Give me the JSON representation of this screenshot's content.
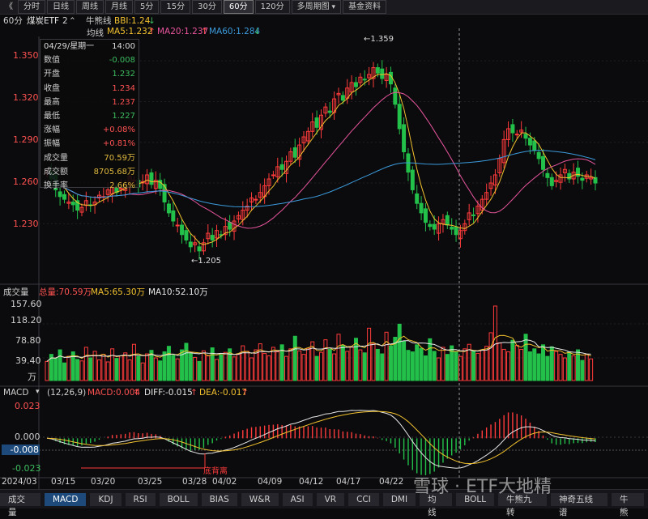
{
  "toolbar": {
    "back_label": "《",
    "items": [
      "分时",
      "日线",
      "周线",
      "月线",
      "5分",
      "15分",
      "30分",
      "60分",
      "120分"
    ],
    "active": "60分",
    "multi_period": "多周期图",
    "fund_info": "基金资料"
  },
  "header": {
    "period": "60分",
    "name": "煤炭ETF",
    "count": "2",
    "bull_label": "牛熊线",
    "bbi": "BBI:1.24",
    "avg_label": "均线",
    "ma5": "MA5:1.232",
    "ma20": "MA20:1.237",
    "ma60": "MA60:1.284",
    "ma5_arrow": "↑",
    "ma20_arrow": "↑",
    "ma60_arrow": "↓",
    "bbi_arrow": "↓"
  },
  "info": {
    "date": "04/29/星期一",
    "time": "14:00",
    "rows": [
      {
        "label": "数值",
        "value": "-0.008",
        "color": "#3dbd5f"
      },
      {
        "label": "开盘",
        "value": "1.232",
        "color": "#3dbd5f"
      },
      {
        "label": "收盘",
        "value": "1.234",
        "color": "#ff5252"
      },
      {
        "label": "最高",
        "value": "1.237",
        "color": "#ff5252"
      },
      {
        "label": "最低",
        "value": "1.227",
        "color": "#3dbd5f"
      },
      {
        "label": "涨幅",
        "value": "+0.08%",
        "color": "#ff5252"
      },
      {
        "label": "振幅",
        "value": "+0.81%",
        "color": "#ff5252"
      },
      {
        "label": "成交量",
        "value": "70.59万",
        "color": "#e0b93c"
      },
      {
        "label": "成交额",
        "value": "8705.68万",
        "color": "#e0b93c"
      },
      {
        "label": "换手率",
        "value": "2.66%",
        "color": "#e0b93c"
      }
    ]
  },
  "price_axis": [
    "1.350",
    "1.320",
    "1.290",
    "1.260",
    "1.230"
  ],
  "annotations": {
    "high": "←1.359",
    "low": "←1.205",
    "divergence": "底背离"
  },
  "volume": {
    "title": "成交量",
    "total": "总量:70.59万",
    "ma5": "MA5:65.30万",
    "ma10": "MA10:52.10万",
    "axis": [
      "157.60",
      "118.20",
      "78.80",
      "39.40",
      "万"
    ]
  },
  "macd": {
    "title": "MACD",
    "params": "(12,26,9)",
    "macd": "MACD:0.004",
    "diff": "DIFF:-0.015",
    "dea": "DEA:-0.017",
    "macd_arrow": "↑",
    "diff_arrow": "↑",
    "dea_arrow": "↑",
    "axis": [
      "0.023",
      "0.000",
      "-0.008",
      "-0.023"
    ]
  },
  "dates": [
    "2024/03",
    "03/15",
    "03/20",
    "03/25",
    "03/28",
    "04/02",
    "04/09",
    "04/12",
    "04/17",
    "04/22"
  ],
  "tabs": [
    "成交量",
    "MACD",
    "KDJ",
    "RSI",
    "BOLL",
    "BIAS",
    "W&R",
    "ASI",
    "VR",
    "CCI",
    "DMI",
    "均线",
    "BOLL",
    "牛熊九转",
    "神奇五线谱",
    "牛熊"
  ],
  "active_tab": "MACD",
  "watermark": "雪球 · ETF大地精",
  "chart_data": {
    "type": "candlestick",
    "title": "煤炭ETF 60分",
    "ylim": [
      1.195,
      1.365
    ],
    "y_ticks": [
      1.23,
      1.26,
      1.29,
      1.32,
      1.35
    ],
    "x_ticks": [
      "2024/03",
      "03/15",
      "03/20",
      "03/25",
      "03/28",
      "04/02",
      "04/09",
      "04/12",
      "04/17",
      "04/22"
    ],
    "price_close": [
      1.268,
      1.263,
      1.255,
      1.25,
      1.248,
      1.246,
      1.244,
      1.24,
      1.242,
      1.247,
      1.244,
      1.246,
      1.251,
      1.25,
      1.255,
      1.258,
      1.253,
      1.256,
      1.257,
      1.265,
      1.262,
      1.257,
      1.261,
      1.266,
      1.259,
      1.262,
      1.256,
      1.246,
      1.238,
      1.232,
      1.229,
      1.222,
      1.218,
      1.213,
      1.216,
      1.21,
      1.216,
      1.223,
      1.218,
      1.225,
      1.222,
      1.228,
      1.226,
      1.232,
      1.236,
      1.24,
      1.243,
      1.249,
      1.248,
      1.253,
      1.258,
      1.263,
      1.266,
      1.272,
      1.27,
      1.276,
      1.283,
      1.279,
      1.288,
      1.294,
      1.298,
      1.305,
      1.301,
      1.31,
      1.316,
      1.312,
      1.322,
      1.326,
      1.321,
      1.33,
      1.334,
      1.331,
      1.338,
      1.336,
      1.34,
      1.345,
      1.341,
      1.337,
      1.34,
      1.333,
      1.318,
      1.3,
      1.283,
      1.268,
      1.255,
      1.245,
      1.238,
      1.231,
      1.228,
      1.226,
      1.23,
      1.233,
      1.229,
      1.226,
      1.222,
      1.225,
      1.23,
      1.238,
      1.236,
      1.243,
      1.248,
      1.253,
      1.26,
      1.266,
      1.278,
      1.292,
      1.3,
      1.297,
      1.296,
      1.299,
      1.293,
      1.288,
      1.284,
      1.278,
      1.27,
      1.264,
      1.258,
      1.262,
      1.266,
      1.27,
      1.263,
      1.268,
      1.265,
      1.262,
      1.266,
      1.264,
      1.26
    ],
    "price_high": 1.359,
    "price_low": 1.205,
    "ma_series": [
      {
        "name": "MA5",
        "color": "#f2c12e"
      },
      {
        "name": "MA20",
        "color": "#e8559d"
      },
      {
        "name": "MA60",
        "color": "#3b9bdc"
      }
    ],
    "volume_ylim": [
      0,
      157.6
    ],
    "volume": [
      38,
      52,
      44,
      61,
      35,
      48,
      57,
      42,
      39,
      66,
      45,
      58,
      41,
      52,
      37,
      63,
      44,
      49,
      55,
      41,
      72,
      48,
      35,
      53,
      60,
      45,
      39,
      57,
      68,
      50,
      43,
      61,
      74,
      55,
      46,
      38,
      59,
      49,
      65,
      42,
      51,
      56,
      63,
      47,
      52,
      69,
      58,
      45,
      61,
      73,
      54,
      49,
      66,
      57,
      71,
      48,
      63,
      88,
      59,
      52,
      64,
      77,
      48,
      56,
      81,
      62,
      53,
      92,
      70,
      58,
      67,
      84,
      61,
      55,
      104,
      74,
      62,
      53,
      96,
      69,
      86,
      112,
      78,
      60,
      57,
      71,
      64,
      49,
      83,
      58,
      45,
      66,
      52,
      69,
      57,
      48,
      63,
      72,
      59,
      54,
      61,
      68,
      95,
      148,
      75,
      62,
      57,
      80,
      70,
      62,
      92,
      57,
      63,
      53,
      71,
      48,
      67,
      58,
      52,
      45,
      57,
      49,
      61,
      40,
      52,
      43
    ],
    "macd_ylim": [
      -0.026,
      0.027
    ]
  }
}
